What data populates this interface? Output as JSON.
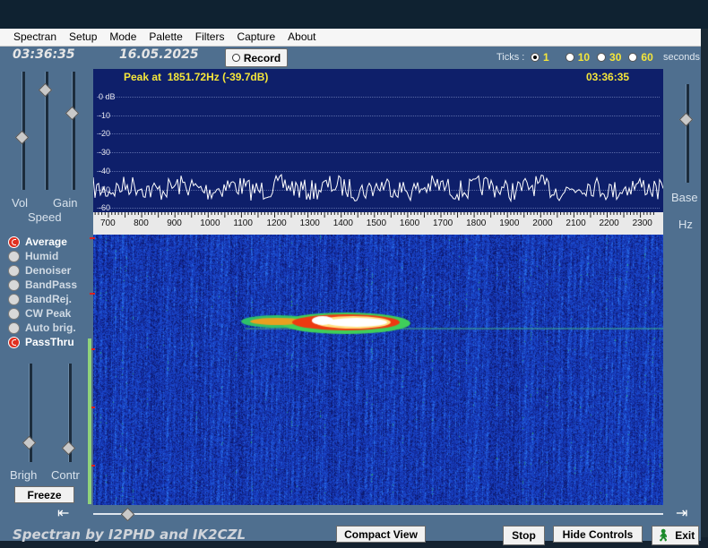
{
  "menu": [
    "Spectran",
    "Setup",
    "Mode",
    "Palette",
    "Filters",
    "Capture",
    "About"
  ],
  "status": {
    "time": "03:36:35",
    "date": "16.05.2025",
    "record_label": "Record",
    "ticks_label": "Ticks :",
    "ticks_options": [
      "1",
      "10",
      "30",
      "60"
    ],
    "ticks_selected": "1",
    "seconds_label": "seconds"
  },
  "spectrum": {
    "peak_text": "Peak at  1851.72Hz (-39.7dB)",
    "peak_time": "03:36:35",
    "db_labels": [
      "0 dB",
      "-10",
      "-20",
      "-30",
      "-40",
      "-50",
      "-60"
    ],
    "freq_labels": [
      "700",
      "800",
      "900",
      "1000",
      "1100",
      "1200",
      "1300",
      "1400",
      "1500",
      "1600",
      "1700",
      "1800",
      "1900",
      "2000",
      "2100",
      "2200",
      "2300"
    ]
  },
  "left_panel": {
    "slider_labels": {
      "vol": "Vol",
      "gain": "Gain",
      "speed": "Speed",
      "brigh": "Brigh",
      "contr": "Contr"
    },
    "slider_levels": {
      "vol": 0.45,
      "speed": 0.85,
      "gain": 0.65,
      "brigh": 0.2,
      "contr": 0.15
    },
    "options": [
      {
        "label": "Average",
        "on": true
      },
      {
        "label": "Humid",
        "on": false
      },
      {
        "label": "Denoiser",
        "on": false
      },
      {
        "label": "BandPass",
        "on": false
      },
      {
        "label": "BandRej.",
        "on": false
      },
      {
        "label": "CW Peak",
        "on": false
      },
      {
        "label": "Auto brig.",
        "on": false
      },
      {
        "label": "PassThru",
        "on": true
      }
    ],
    "freeze_label": "Freeze"
  },
  "right_panel": {
    "base_label": "Base",
    "hz_label": "Hz",
    "base_level": 0.65
  },
  "bottom": {
    "compact_view_label": "Compact View",
    "stop_label": "Stop",
    "hide_controls_label": "Hide Controls",
    "exit_label": "Exit",
    "credits": "Spectran  by I2PHD and IK2CZL",
    "scroll_level": 0.02
  },
  "colors": {
    "window_bg": "#4f6f8f",
    "spectrum_bg": "#0e1f6a",
    "accent_yellow": "#f5e63a",
    "waterfall_base": "#1638a8"
  }
}
